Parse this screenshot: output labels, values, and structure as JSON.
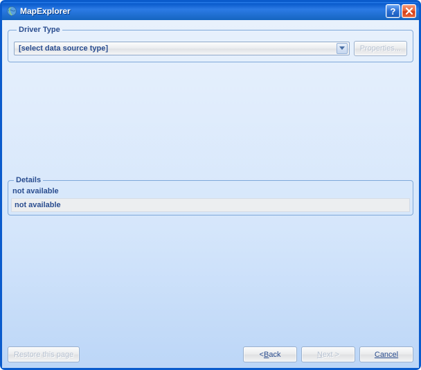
{
  "window": {
    "title": "MapExplorer"
  },
  "driver": {
    "legend": "Driver Type",
    "selected": "[select data source type]",
    "properties_label": "Properties..."
  },
  "details": {
    "legend": "Details",
    "line1": "not available",
    "line2": "not available"
  },
  "footer": {
    "restore": "Restore this page",
    "back_prefix": "< ",
    "back_key": "B",
    "back_rest": "ack",
    "next_key": "N",
    "next_rest": "ext >",
    "cancel": "Cancel"
  }
}
